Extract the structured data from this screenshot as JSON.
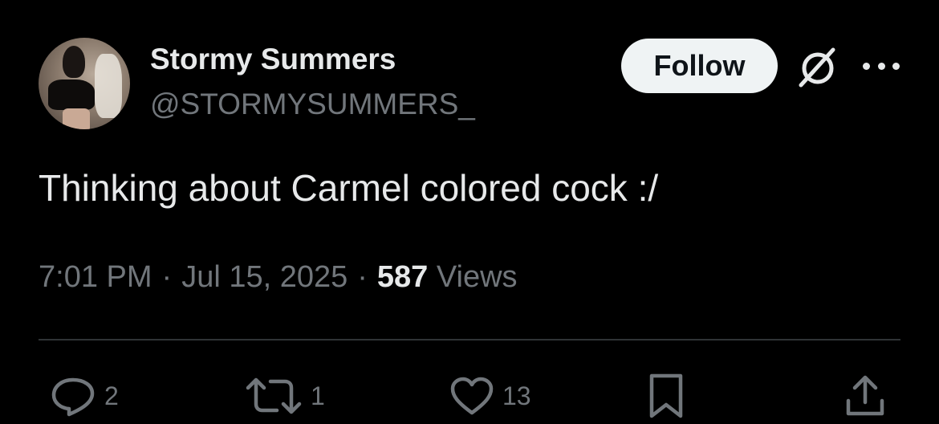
{
  "author": {
    "display_name": "Stormy Summers",
    "handle": "@STORMYSUMMERS_",
    "avatar_icon": "profile-photo"
  },
  "header_actions": {
    "follow_label": "Follow",
    "grok_icon": "grok-icon",
    "more_icon": "more-dots-icon"
  },
  "tweet": {
    "text": "Thinking about Carmel colored cock :/",
    "time": "7:01 PM",
    "date": "Jul 15, 2025",
    "separator": "·",
    "views_count": "587",
    "views_label": "Views"
  },
  "actions": {
    "replies": "2",
    "reposts": "1",
    "likes": "13",
    "icons": [
      "reply-icon",
      "repost-icon",
      "like-icon",
      "bookmark-icon",
      "share-icon"
    ]
  },
  "colors": {
    "background": "#000000",
    "text_primary": "#e7e9ea",
    "text_secondary": "#71767b",
    "follow_button_bg": "#eff3f4",
    "divider": "#2f3336"
  }
}
